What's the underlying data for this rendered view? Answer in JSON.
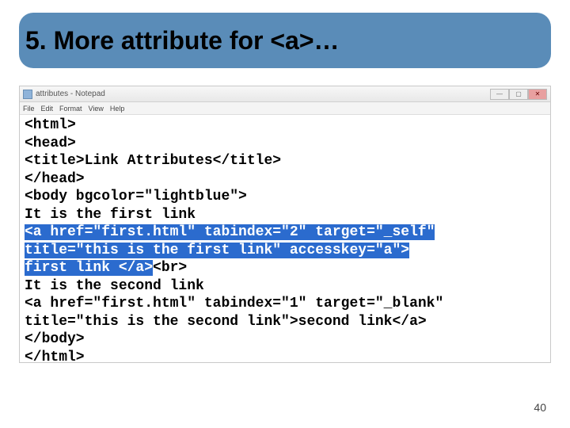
{
  "banner": {
    "title": "5. More attribute for <a>…"
  },
  "notepad": {
    "title": "attributes - Notepad",
    "menus": [
      "File",
      "Edit",
      "Format",
      "View",
      "Help"
    ],
    "controls": {
      "min": "—",
      "max": "▢",
      "close": "✕"
    }
  },
  "code": {
    "l1": "<html>",
    "l2": "<head>",
    "l3": "<title>Link Attributes</title>",
    "l4": "</head>",
    "l5": "<body bgcolor=\"lightblue\">",
    "l6": "It is the first link",
    "l7a": "<a href=\"first.html\" tabindex=\"2\" target=\"_self\"",
    "l8a": "title=\"this is the first link\" accesskey=\"a\">",
    "l9a": "first link </a>",
    "l9b": "<br>",
    "l10": "It is the second link",
    "l11": "<a href=\"first.html\" tabindex=\"1\" target=\"_blank\"",
    "l12": "title=\"this is the second link\">second link</a>",
    "l13": "</body>",
    "l14": "</html>"
  },
  "pageNumber": "40"
}
